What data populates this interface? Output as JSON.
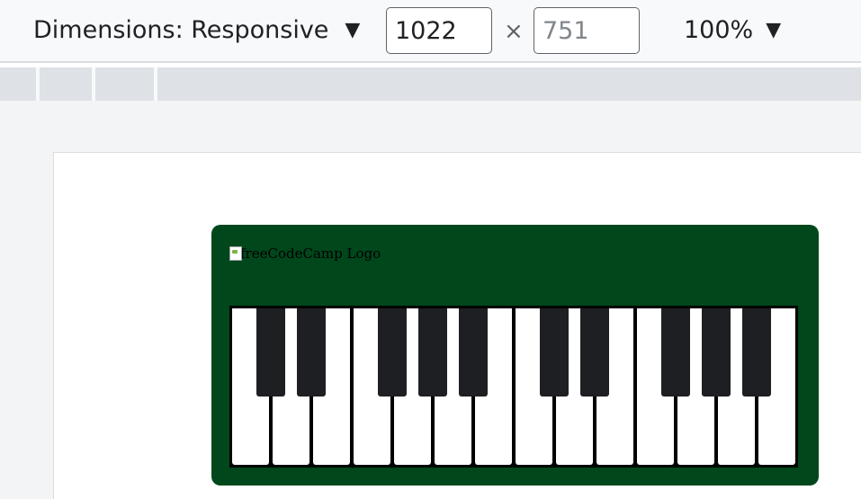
{
  "toolbar": {
    "dimensions_label": "Dimensions: Responsive",
    "width_value": "1022",
    "height_placeholder": "751",
    "times_symbol": "×",
    "zoom_label": "100%"
  },
  "page": {
    "logo_alt": "freeCodeCamp Logo"
  },
  "piano": {
    "white_keys": 14,
    "black_keys": 10,
    "bg_color": "#00471b"
  }
}
